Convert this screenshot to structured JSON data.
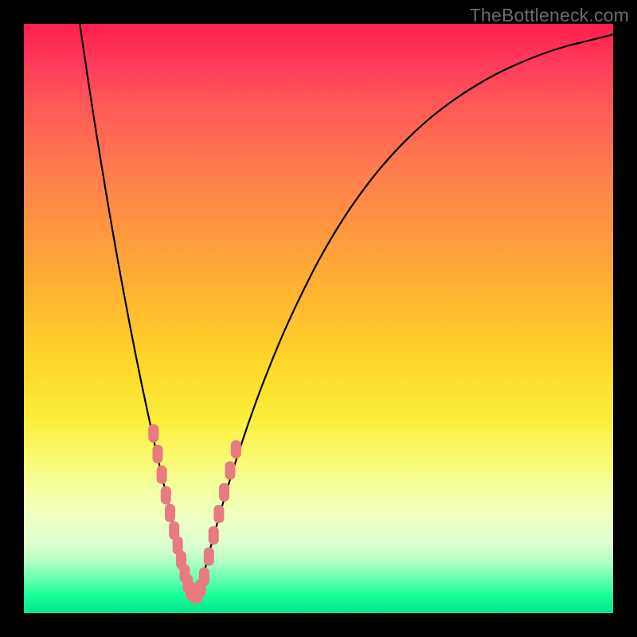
{
  "watermark": "TheBottleneck.com",
  "colors": {
    "background": "#000000",
    "curve_stroke": "#000000",
    "marker_fill": "#e97a7f",
    "watermark_text": "#6b6b6b"
  },
  "chart_data": {
    "type": "line",
    "title": "",
    "xlabel": "",
    "ylabel": "",
    "xlim": [
      0,
      100
    ],
    "ylim": [
      0,
      100
    ],
    "grid": false,
    "legend": false,
    "series": [
      {
        "name": "left-curve",
        "x": [
          9.5,
          10,
          11,
          12,
          13,
          14,
          15,
          16,
          17,
          18,
          19,
          20,
          21,
          22,
          23,
          24,
          25,
          26,
          27,
          27.5
        ],
        "y": [
          100,
          96.5,
          89.8,
          83.3,
          77.1,
          71.0,
          65.2,
          59.5,
          54.1,
          48.8,
          43.7,
          38.8,
          34.1,
          29.5,
          25.1,
          20.8,
          16.6,
          12.5,
          8.5,
          6.5
        ]
      },
      {
        "name": "right-curve",
        "x": [
          30.5,
          31,
          32,
          34,
          36,
          38,
          40,
          42,
          44,
          46,
          48,
          50,
          53,
          56,
          60,
          64,
          68,
          72,
          76,
          80,
          84,
          88,
          92,
          96,
          100
        ],
        "y": [
          6.5,
          8.5,
          12.3,
          19.4,
          25.9,
          31.9,
          37.5,
          42.6,
          47.4,
          51.8,
          55.9,
          59.8,
          65.0,
          69.6,
          74.9,
          79.4,
          83.2,
          86.4,
          89.1,
          91.4,
          93.3,
          94.9,
          96.2,
          97.2,
          98.2
        ]
      }
    ],
    "markers": {
      "shape": "rounded-rect",
      "points_xy": [
        [
          22.0,
          30.5
        ],
        [
          22.7,
          27.0
        ],
        [
          23.4,
          23.5
        ],
        [
          24.1,
          20.0
        ],
        [
          24.8,
          17.0
        ],
        [
          25.5,
          14.0
        ],
        [
          26.1,
          11.5
        ],
        [
          26.7,
          9.0
        ],
        [
          27.3,
          6.7
        ],
        [
          27.8,
          5.0
        ],
        [
          28.3,
          3.8
        ],
        [
          28.9,
          3.2
        ],
        [
          29.5,
          3.3
        ],
        [
          30.0,
          4.2
        ],
        [
          30.6,
          6.2
        ],
        [
          31.4,
          9.6
        ],
        [
          32.2,
          13.2
        ],
        [
          33.1,
          16.8
        ],
        [
          34.0,
          20.5
        ],
        [
          35.0,
          24.2
        ],
        [
          36.0,
          27.8
        ]
      ]
    }
  }
}
